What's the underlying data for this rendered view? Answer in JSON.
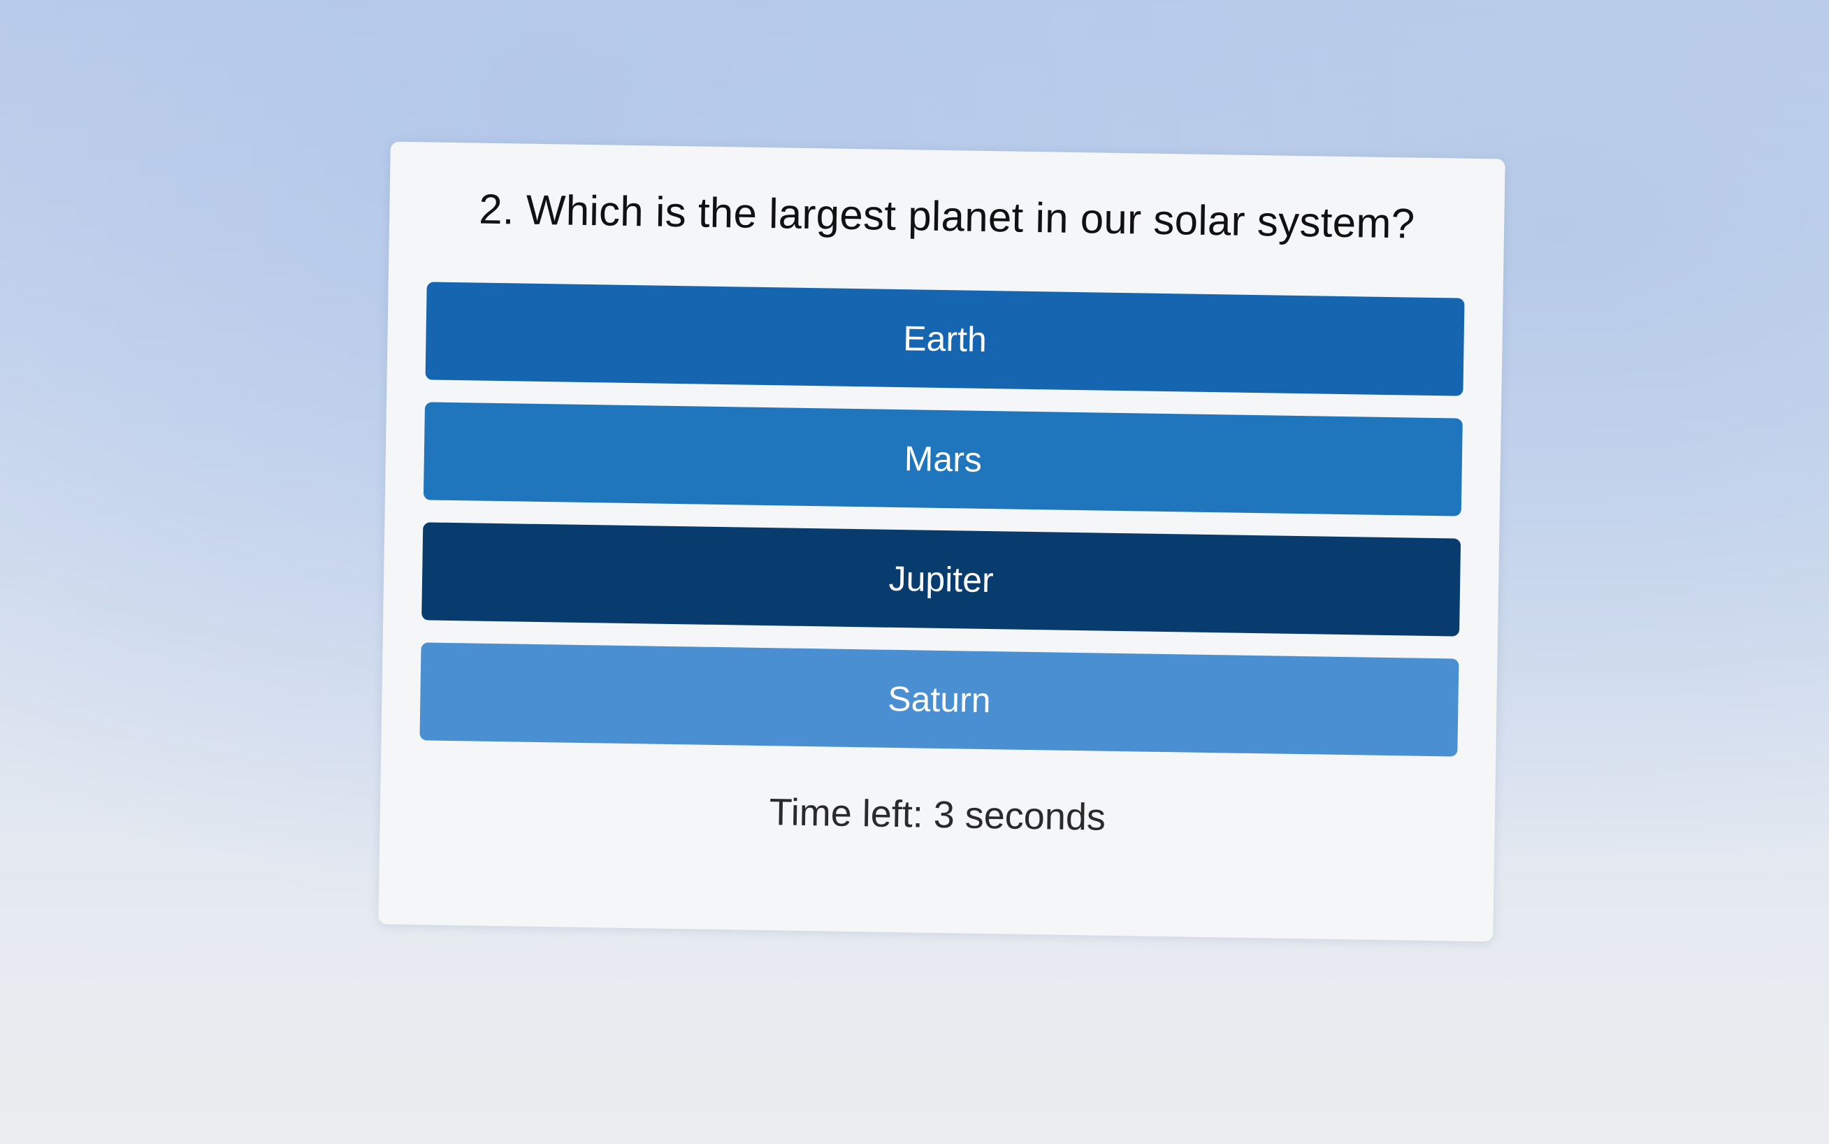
{
  "quiz": {
    "question": "2. Which is the largest planet in our solar system?",
    "options": [
      {
        "label": "Earth",
        "color": "#1565b0"
      },
      {
        "label": "Mars",
        "color": "#1f76bd"
      },
      {
        "label": "Jupiter",
        "color": "#083c6e"
      },
      {
        "label": "Saturn",
        "color": "#4a8fd1"
      }
    ],
    "timer_text": "Time left: 3 seconds"
  }
}
